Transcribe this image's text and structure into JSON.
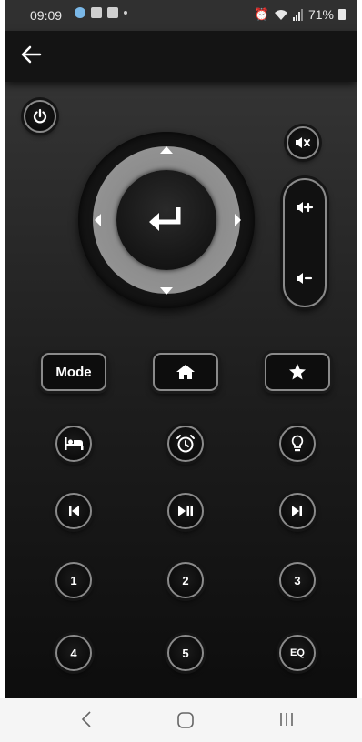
{
  "status_bar": {
    "time": "09:09",
    "battery": "71%"
  },
  "buttons": {
    "mode": "Mode",
    "num1": "1",
    "num2": "2",
    "num3": "3",
    "num4": "4",
    "num5": "5",
    "eq": "EQ"
  },
  "colors": {
    "background_top": "#3a3a3a",
    "background_bottom": "#0d0d0d",
    "button_ring": "#8a8a8a",
    "dpad_ring": "#8e8e8e",
    "icon": "#ffffff"
  },
  "icons": [
    "back-arrow-icon",
    "power-icon",
    "mute-icon",
    "volume-up-icon",
    "volume-down-icon",
    "enter-icon",
    "home-icon",
    "star-icon",
    "sleep-icon",
    "alarm-icon",
    "bulb-icon",
    "previous-icon",
    "play-pause-icon",
    "next-icon"
  ]
}
